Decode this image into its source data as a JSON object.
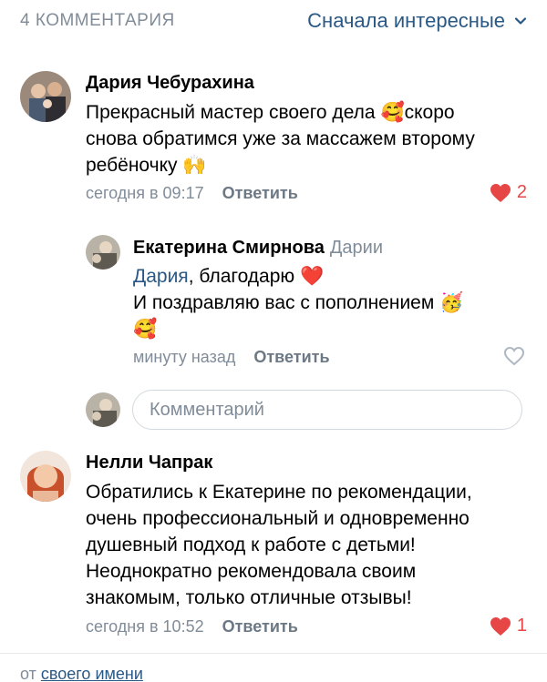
{
  "header": {
    "count_label": "4 КОММЕНТАРИЯ",
    "sort_label": "Сначала интересные",
    "sort_icon": "chevron-down-icon"
  },
  "comments": [
    {
      "author": "Дария Чебурахина",
      "text_lines": [
        "Прекрасный мастер своего дела 🥰скоро",
        "снова обратимся уже за массажем второму",
        "ребёночку 🙌"
      ],
      "time": "сегодня в 09:17",
      "reply_label": "Ответить",
      "likes": "2",
      "liked": true
    },
    {
      "author": "Екатерина Смирнова",
      "reply_to": "Дарии",
      "mention": "Дария",
      "text_line1_rest": ", благодарю ❤️",
      "text_line2": "И поздравляю вас с пополнением 🥳",
      "text_line3": "🥰",
      "time": "минуту назад",
      "reply_label": "Ответить",
      "liked": false
    },
    {
      "author": "Нелли Чапрак",
      "text_lines": [
        "Обратились к Екатерине по рекомендации,",
        "очень профессиональный и одновременно",
        "душевный подход к работе с детьми!",
        "Неоднократно рекомендовала своим",
        "знакомым, только отличные отзывы!"
      ],
      "time": "сегодня в 10:52",
      "reply_label": "Ответить",
      "likes": "1",
      "liked": true
    }
  ],
  "composer": {
    "placeholder": "Комментарий"
  },
  "footer": {
    "prefix": "от ",
    "link": "своего имени"
  },
  "colors": {
    "link": "#2a5885",
    "muted": "#818c99",
    "like": "#e64646"
  }
}
